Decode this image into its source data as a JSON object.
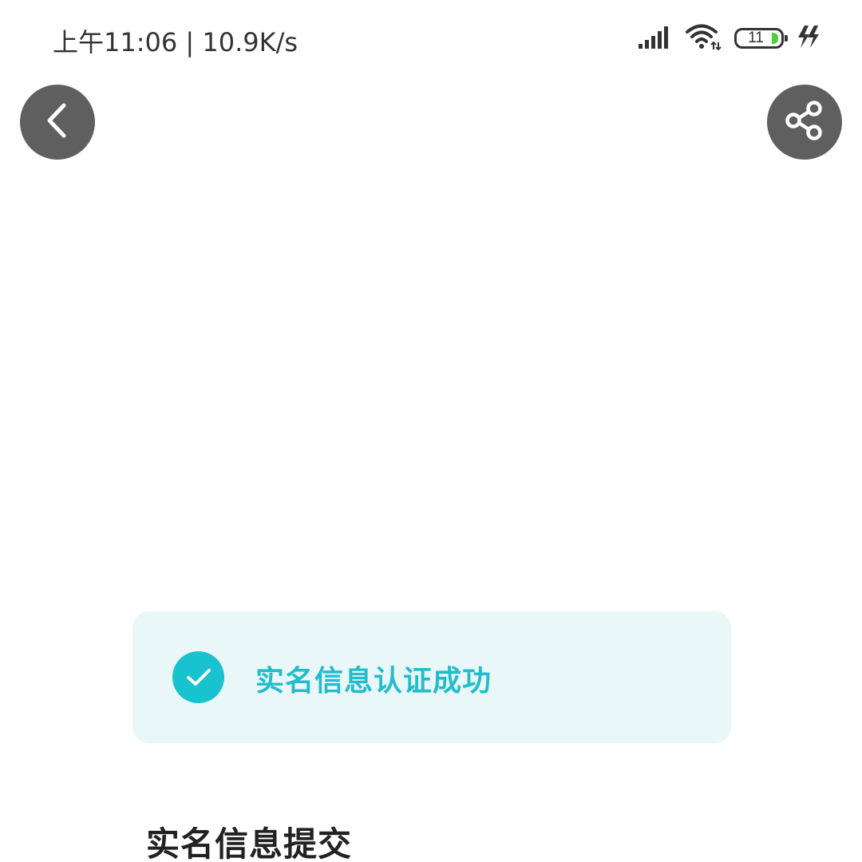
{
  "status_bar": {
    "time_speed": "上午11:06 | 10.9K/s",
    "battery_level": "11",
    "icons": [
      "signal-icon",
      "wifi-icon",
      "battery-icon",
      "charging-icon"
    ]
  },
  "nav": {
    "back_icon": "back-chevron-icon",
    "share_icon": "share-icon"
  },
  "success": {
    "message": "实名信息认证成功",
    "icon": "check-icon"
  },
  "section": {
    "title": "实名信息提交"
  },
  "colors": {
    "accent": "#18c2cf",
    "accent_text": "#23bccb",
    "card_bg": "#e9f7f9",
    "nav_button_bg": "#5f5f5f"
  }
}
